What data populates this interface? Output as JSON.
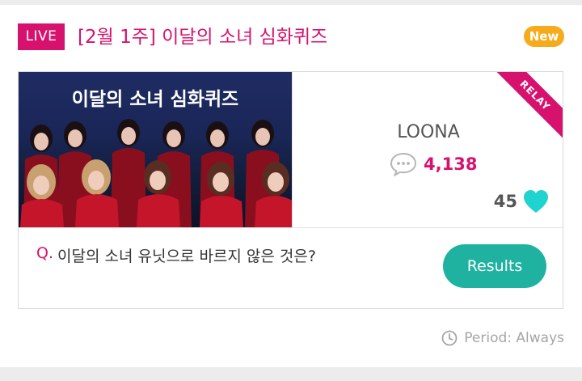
{
  "header": {
    "live_label": "LIVE",
    "title": "[2월 1주] 이달의 소녀 심화퀴즈",
    "new_label": "New"
  },
  "quiz": {
    "thumbnail_caption": "이달의 소녀 심화퀴즈",
    "relay_label": "RELAY",
    "artist": "LOONA",
    "comment_count": "4,138",
    "like_count": "45",
    "question_prefix": "Q.",
    "question": "이달의 소녀 유닛으로 바르지 않은 것은?",
    "results_label": "Results"
  },
  "footer": {
    "period": "Period: Always"
  },
  "icons": {
    "comment": "speech-bubble-icon",
    "like": "heart-icon",
    "period": "clock-icon"
  },
  "colors": {
    "brand": "#d7126e",
    "new_badge": "#f5ab1b",
    "results_button": "#20b2a0",
    "heart": "#1fd3d0"
  }
}
